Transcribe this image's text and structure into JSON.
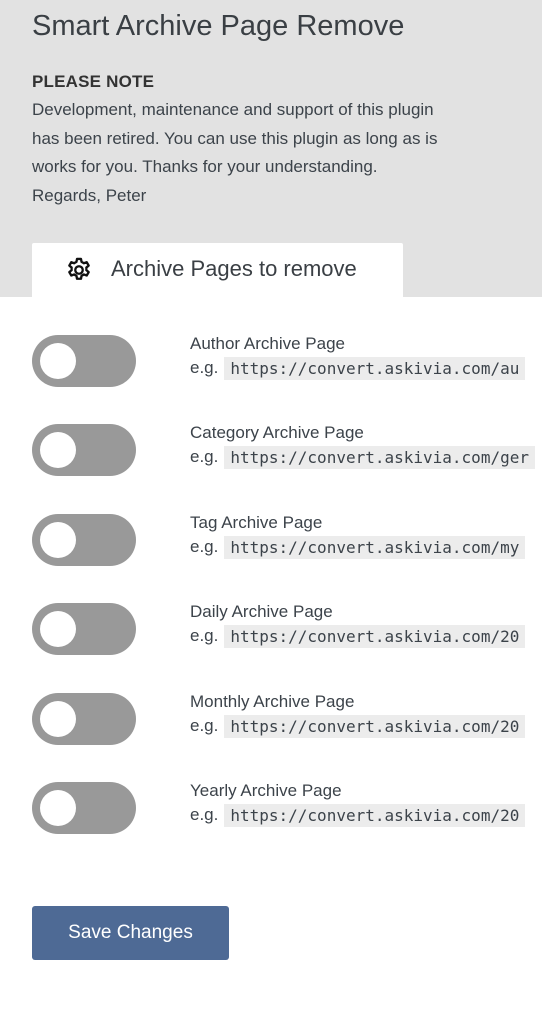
{
  "page": {
    "title": "Smart Archive Page Remove"
  },
  "notice": {
    "heading": "PLEASE NOTE",
    "lines": [
      "Development, maintenance and support of this plugin",
      "has been retired. You can use this plugin as long as is",
      "works for you. Thanks for your understanding.",
      "Regards, Peter"
    ]
  },
  "tab": {
    "icon": "gear-icon",
    "label": "Archive Pages to remove"
  },
  "options": [
    {
      "label": "Author Archive Page",
      "eg": "e.g.",
      "example_url": "https://convert.askivia.com/au",
      "enabled": false
    },
    {
      "label": "Category Archive Page",
      "eg": "e.g.",
      "example_url": "https://convert.askivia.com/ger",
      "enabled": false
    },
    {
      "label": "Tag Archive Page",
      "eg": "e.g.",
      "example_url": "https://convert.askivia.com/my",
      "enabled": false
    },
    {
      "label": "Daily Archive Page",
      "eg": "e.g.",
      "example_url": "https://convert.askivia.com/20",
      "enabled": false
    },
    {
      "label": "Monthly Archive Page",
      "eg": "e.g.",
      "example_url": "https://convert.askivia.com/20",
      "enabled": false
    },
    {
      "label": "Yearly Archive Page",
      "eg": "e.g.",
      "example_url": "https://convert.askivia.com/20",
      "enabled": false
    }
  ],
  "actions": {
    "save_label": "Save Changes"
  },
  "colors": {
    "header_bg": "#e2e2e2",
    "toggle_off": "#999999",
    "button_bg": "#4e6a95"
  }
}
